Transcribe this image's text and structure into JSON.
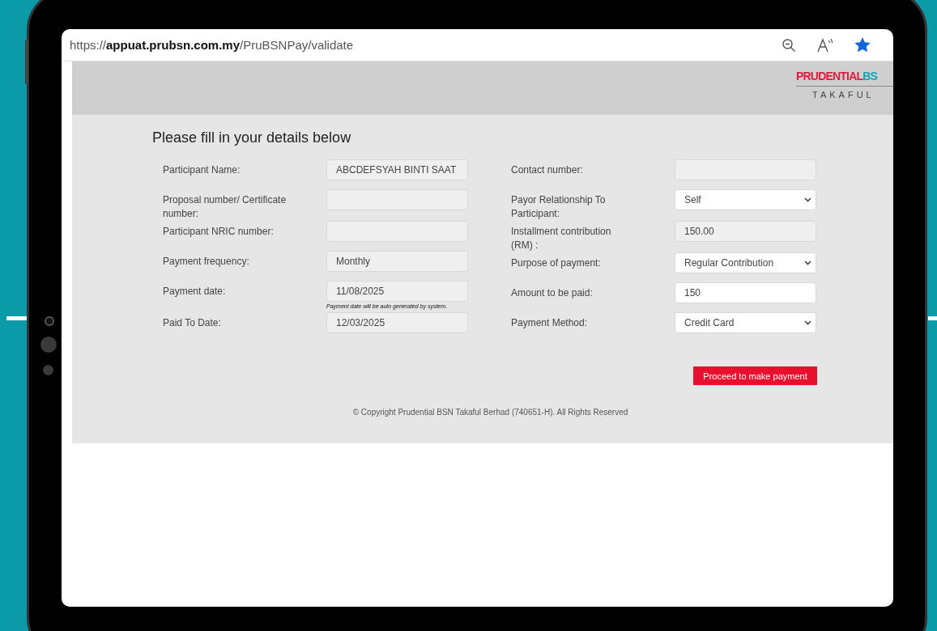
{
  "browser": {
    "url": "https://**appuat.prubsn.com.my**/PruBSNPay/validate"
  },
  "logo": {
    "brand": "PRUDENTIAL",
    "brand_cut": "BS",
    "subtitle": "TAKAFUL"
  },
  "heading": "Please fill in your details below",
  "left_fields": [
    {
      "label": "Participant Name:",
      "kind": "input",
      "readonly": true,
      "value": "ABCDEFSYAH BINTI SAAT"
    },
    {
      "label": "Proposal number/ Certificate number:",
      "kind": "input",
      "readonly": true
    },
    {
      "label": "Participant NRIC number:",
      "kind": "input",
      "readonly": true
    },
    {
      "label": "Payment frequency:",
      "kind": "input",
      "readonly": true,
      "value": "Monthly"
    },
    {
      "label": "Payment date:",
      "kind": "input",
      "readonly": true,
      "value": "11/08/2025",
      "hint": "Payment date will be auto generated by system."
    },
    {
      "label": "Paid To Date:",
      "kind": "input",
      "readonly": true,
      "value": "12/03/2025"
    }
  ],
  "right_fields": [
    {
      "label": "Contact number:",
      "kind": "input",
      "readonly": true
    },
    {
      "label": "Payor Relationship To Participant:",
      "kind": "select",
      "readonly": false,
      "value": "Self"
    },
    {
      "label": "Installment contribution (RM) :",
      "kind": "input",
      "readonly": true,
      "value": "150.00"
    },
    {
      "label": "Purpose of payment:",
      "kind": "select",
      "readonly": false,
      "value": "Regular Contribution"
    },
    {
      "label": "Amount to be paid:",
      "kind": "input",
      "readonly": false,
      "value": "150"
    },
    {
      "label": "Payment Method:",
      "kind": "select",
      "readonly": false,
      "value": "Credit Card"
    }
  ],
  "submit": "Proceed to make payment",
  "footer": "© Copyright Prudential BSN Takaful Berhad (740651-H). All Rights Reserved"
}
